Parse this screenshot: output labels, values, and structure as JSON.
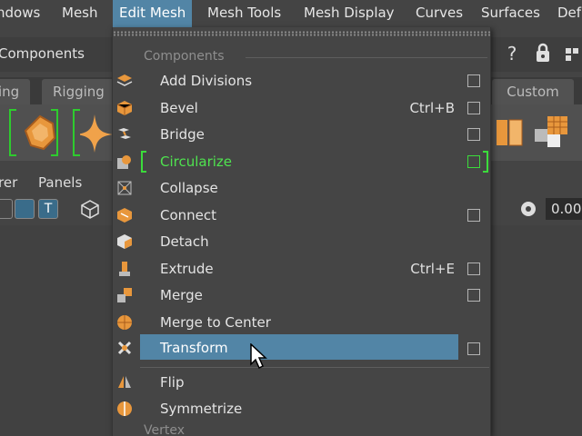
{
  "menubar": {
    "items": [
      "ndows",
      "Mesh",
      "Edit Mesh",
      "Mesh Tools",
      "Mesh Display",
      "Curves",
      "Surfaces",
      "Def"
    ],
    "active": "Edit Mesh"
  },
  "status_line": {
    "mode_label": "Components"
  },
  "shelf_tabs": [
    "ing",
    "Rigging",
    "Custom"
  ],
  "panel_bar": {
    "items": [
      "rer",
      "Panels"
    ]
  },
  "viewport_field": {
    "value": "0.00"
  },
  "menu": {
    "section_components": "Components",
    "items": [
      {
        "label": "Add Divisions",
        "shortcut": "",
        "option_box": true,
        "icon": "add-divisions-icon"
      },
      {
        "label": "Bevel",
        "shortcut": "Ctrl+B",
        "option_box": true,
        "icon": "bevel-icon"
      },
      {
        "label": "Bridge",
        "shortcut": "",
        "option_box": true,
        "icon": "bridge-icon"
      },
      {
        "label": "Circularize",
        "shortcut": "",
        "option_box": true,
        "icon": "circularize-icon",
        "highlight_color": "#4fe34f"
      },
      {
        "label": "Collapse",
        "shortcut": "",
        "option_box": false,
        "icon": "collapse-icon"
      },
      {
        "label": "Connect",
        "shortcut": "",
        "option_box": true,
        "icon": "connect-icon"
      },
      {
        "label": "Detach",
        "shortcut": "",
        "option_box": false,
        "icon": "detach-icon"
      },
      {
        "label": "Extrude",
        "shortcut": "Ctrl+E",
        "option_box": true,
        "icon": "extrude-icon"
      },
      {
        "label": "Merge",
        "shortcut": "",
        "option_box": true,
        "icon": "merge-icon"
      },
      {
        "label": "Merge to Center",
        "shortcut": "",
        "option_box": false,
        "icon": "merge-to-center-icon"
      },
      {
        "label": "Transform",
        "shortcut": "",
        "option_box": true,
        "icon": "transform-icon",
        "hovered": true
      },
      {
        "label": "Flip",
        "shortcut": "",
        "option_box": false,
        "icon": "flip-icon"
      },
      {
        "label": "Symmetrize",
        "shortcut": "",
        "option_box": false,
        "icon": "symmetrize-icon"
      }
    ],
    "section_vertex": "Vertex"
  },
  "colors": {
    "accent": "#5285a6",
    "green": "#4fe34f",
    "icon_orange": "#e8973c"
  }
}
